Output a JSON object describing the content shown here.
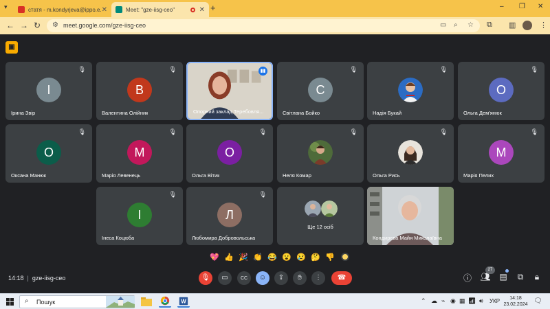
{
  "browser": {
    "tabs": [
      {
        "title": "статя - m.kondyrjeva@ippo.e...",
        "favicon_color": "#d93025"
      },
      {
        "title": "Meet: \"gze-iisg-ceo\"",
        "favicon_color": "#00897b",
        "recording": true
      }
    ],
    "url": "meet.google.com/gze-iisg-ceo",
    "window_controls": [
      "–",
      "❐",
      "✕"
    ]
  },
  "meeting": {
    "code": "gze-iisg-ceo",
    "time": "14:18",
    "participants_count": "27",
    "tiles": [
      {
        "name": "Ірина Звір",
        "initial": "І",
        "color": "#7a8a91"
      },
      {
        "name": "Валентина Олійник",
        "initial": "В",
        "color": "#c1381c"
      },
      {
        "name": "Опорний заклад Теребовля...",
        "video": true,
        "speaking": true
      },
      {
        "name": "Світлана Бойко",
        "initial": "С",
        "color": "#7a8a91"
      },
      {
        "name": "Надія Букай",
        "photo": true
      },
      {
        "name": "Ольга Дем'янюк",
        "initial": "О",
        "color": "#5c6bc0"
      },
      {
        "name": "Оксана Манюк",
        "initial": "О",
        "color": "#0b5d4a"
      },
      {
        "name": "Марія Левенець",
        "initial": "М",
        "color": "#c2185b"
      },
      {
        "name": "Ольга Вітик",
        "initial": "О",
        "color": "#7b1fa2"
      },
      {
        "name": "Неля Комар",
        "photo": true
      },
      {
        "name": "Ольга Рись",
        "photo": true
      },
      {
        "name": "Марія Пелих",
        "initial": "М",
        "color": "#ab47bc"
      },
      {
        "name": "Інеса Коцюба",
        "initial": "І",
        "color": "#2e7d32"
      },
      {
        "name": "Любомира Добровольська",
        "initial": "Л",
        "color": "#8d6e63"
      },
      {
        "more_label": "Ще 12 осіб"
      },
      {
        "name": "Кондирєва Майя Миколаївна",
        "video": true
      }
    ],
    "reactions": [
      "💖",
      "👍",
      "🎉",
      "👏",
      "😂",
      "😮",
      "😢",
      "🤔",
      "👎"
    ]
  },
  "taskbar": {
    "search_placeholder": "Пошук",
    "language": "УКР",
    "time": "14:18",
    "date": "23.02.2024"
  }
}
